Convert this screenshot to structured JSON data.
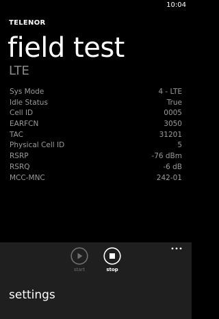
{
  "status_bar": {
    "time": "10:04"
  },
  "header": {
    "app_title": "TELENOR",
    "page_title": "field test",
    "subtitle": "LTE"
  },
  "info_rows": [
    {
      "label": "Sys Mode",
      "value": "4 - LTE"
    },
    {
      "label": "Idle Status",
      "value": "True"
    },
    {
      "label": "Cell ID",
      "value": "0005"
    },
    {
      "label": "EARFCN",
      "value": "3050"
    },
    {
      "label": "TAC",
      "value": "31201"
    },
    {
      "label": "Physical Cell ID",
      "value": "5"
    },
    {
      "label": "RSRP",
      "value": "-76 dBm"
    },
    {
      "label": "RSRQ",
      "value": "-6 dB"
    },
    {
      "label": "MCC-MNC",
      "value": "242-01"
    }
  ],
  "app_bar": {
    "buttons": [
      {
        "label": "start",
        "icon": "play-icon",
        "enabled": false
      },
      {
        "label": "stop",
        "icon": "stop-icon",
        "enabled": true
      }
    ],
    "more_icon": "ellipsis-icon",
    "menu_items": [
      {
        "label": "settings"
      }
    ]
  },
  "colors": {
    "background": "#000000",
    "app_bar_background": "#1f1f1f",
    "secondary_text": "#9a9a9a",
    "disabled": "#6f6f6f"
  }
}
